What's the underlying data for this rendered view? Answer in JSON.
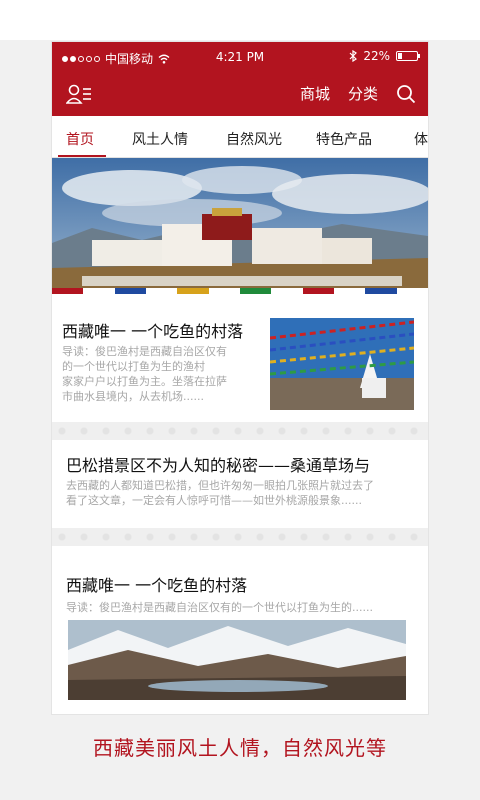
{
  "statusbar": {
    "carrier": "中国移动",
    "time": "4:21 PM",
    "battery": "22%",
    "battery_level": 0.22,
    "icons": [
      "signal-dots-icon",
      "wifi-icon",
      "bluetooth-icon",
      "battery-icon"
    ]
  },
  "header": {
    "menu_icon": "user-list-icon",
    "shop_label": "商城",
    "category_label": "分类",
    "search_icon": "search-icon"
  },
  "tabs": {
    "items": [
      {
        "label": "首页",
        "active": true
      },
      {
        "label": "风土人情",
        "active": false
      },
      {
        "label": "自然风光",
        "active": false
      },
      {
        "label": "特色产品",
        "active": false
      },
      {
        "label": "体",
        "active": false
      }
    ]
  },
  "articles": [
    {
      "title": "西藏唯一 一个吃鱼的村落",
      "desc_lines": [
        "导读：俊巴渔村是西藏自治区仅有",
        "的一个世代以打鱼为生的渔村",
        "家家户户以打鱼为主。坐落在拉萨",
        "市曲水县境内，从去机场......"
      ]
    },
    {
      "title": "巴松措景区不为人知的秘密——桑通草场与",
      "desc_lines": [
        "去西藏的人都知道巴松措，但也许匆匆一眼拍几张照片就过去了",
        "看了这文章，一定会有人惊呼可惜——如世外桃源般景象......"
      ]
    },
    {
      "title": "西藏唯一 一个吃鱼的村落",
      "desc_lines": [
        "导读：俊巴渔村是西藏自治区仅有的一个世代以打鱼为生的......"
      ]
    }
  ],
  "caption": "西藏美丽风土人情，自然风光等",
  "colors": {
    "brand": "#b2141f",
    "text": "#111111",
    "muted": "#a7a7a7"
  }
}
